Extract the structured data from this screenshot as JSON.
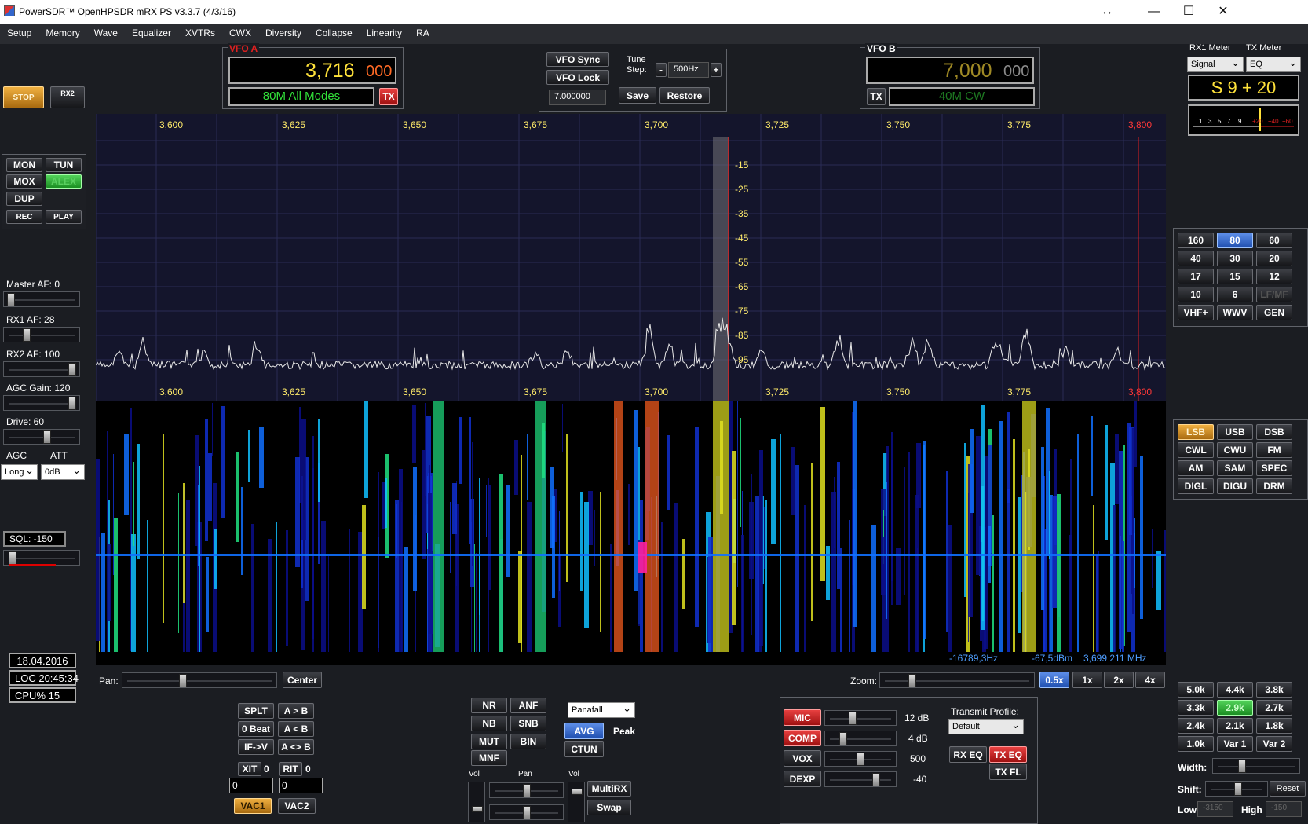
{
  "window": {
    "title": "PowerSDR™ OpenHPSDR mRX PS v3.3.7 (4/3/16)",
    "btn_resize": "↔",
    "btn_min": "—",
    "btn_max": "☐",
    "btn_close": "✕"
  },
  "menu": [
    "Setup",
    "Memory",
    "Wave",
    "Equalizer",
    "XVTRs",
    "CWX",
    "Diversity",
    "Collapse",
    "Linearity",
    "RA"
  ],
  "left": {
    "stop": "STOP",
    "rx2": "RX2",
    "mon": "MON",
    "tun": "TUN",
    "mox": "MOX",
    "alex": "ALEX",
    "dup": "DUP",
    "rec": "REC",
    "play": "PLAY",
    "master_af": "Master AF:  0",
    "rx1_af": "RX1 AF:  28",
    "rx2_af": "RX2 AF:  100",
    "agc_gain": "AGC Gain:  120",
    "drive": "Drive:  60",
    "agc": "AGC",
    "att": "ATT",
    "agc_val": "Long",
    "att_val": "0dB",
    "sql": "SQL:  -150",
    "date": "18.04.2016",
    "loc": "LOC 20:45:34",
    "cpu": "CPU%  15"
  },
  "vfoa": {
    "label": "VFO A",
    "freq_main": "3,716",
    "freq_sub": "000",
    "band": "80M All Modes",
    "tx": "TX"
  },
  "vfob": {
    "label": "VFO B",
    "freq_main": "7,000",
    "freq_sub": "000",
    "band": "40M CW",
    "tx": "TX"
  },
  "center": {
    "vfo_sync": "VFO Sync",
    "vfo_lock": "VFO Lock",
    "tune_step": "Tune\nStep:",
    "step_val": "500Hz",
    "minus": "-",
    "plus": "+",
    "freq_entry": "7.000000",
    "save": "Save",
    "restore": "Restore"
  },
  "meter": {
    "rx1_meter": "RX1 Meter",
    "tx_meter": "TX Meter",
    "rx_sel": "Signal",
    "tx_sel": "EQ",
    "reading": "S 9 + 20",
    "scale": [
      "1",
      "3",
      "5",
      "7",
      "9",
      "+20",
      "+40",
      "+60"
    ]
  },
  "spectrum": {
    "freq_ticks": [
      "3,600",
      "3,625",
      "3,650",
      "3,675",
      "3,700",
      "3,725",
      "3,750",
      "3,775",
      "3,800"
    ],
    "db_ticks": [
      "-15",
      "-25",
      "-35",
      "-45",
      "-55",
      "-65",
      "-75",
      "-85",
      "-95"
    ],
    "cursor_hz": "-16789,3Hz",
    "cursor_dbm": "-67,5dBm",
    "cursor_mhz": "3,699 211 MHz"
  },
  "bands": [
    "160",
    "80",
    "60",
    "40",
    "30",
    "20",
    "17",
    "15",
    "12",
    "10",
    "6",
    "LF/MF",
    "VHF+",
    "WWV",
    "GEN"
  ],
  "modes": [
    "LSB",
    "USB",
    "DSB",
    "CWL",
    "CWU",
    "FM",
    "AM",
    "SAM",
    "SPEC",
    "DIGL",
    "DIGU",
    "DRM"
  ],
  "filters": [
    "5.0k",
    "4.4k",
    "3.8k",
    "3.3k",
    "2.9k",
    "2.7k",
    "2.4k",
    "2.1k",
    "1.8k",
    "1.0k",
    "Var 1",
    "Var 2"
  ],
  "filter_ctrl": {
    "width": "Width:",
    "shift": "Shift:",
    "reset": "Reset",
    "low": "Low",
    "low_val": "-3150",
    "high": "High",
    "high_val": "-150"
  },
  "pan": {
    "pan": "Pan:",
    "center": "Center",
    "zoom": "Zoom:",
    "z05": "0.5x",
    "z1": "1x",
    "z2": "2x",
    "z4": "4x"
  },
  "split": {
    "splt": "SPLT",
    "atob": "A > B",
    "zerobeat": "0 Beat",
    "btoa": "A < B",
    "ifv": "IF->V",
    "swap": "A <> B",
    "xit": "XIT",
    "xit_v": "0",
    "rit": "RIT",
    "rit_v": "0",
    "xit_num": "0",
    "rit_num": "0",
    "vac1": "VAC1",
    "vac2": "VAC2"
  },
  "dsp": {
    "nr": "NR",
    "anf": "ANF",
    "nb": "NB",
    "snb": "SNB",
    "mut": "MUT",
    "bin": "BIN",
    "mnf": "MNF",
    "display_mode": "Panafall",
    "avg": "AVG",
    "peak": "Peak",
    "ctun": "CTUN",
    "vol1": "Vol",
    "pan": "Pan",
    "vol2": "Vol",
    "multirx": "MultiRX",
    "swap": "Swap"
  },
  "tx": {
    "mic": "MIC",
    "mic_v": "12 dB",
    "comp": "COMP",
    "comp_v": "4 dB",
    "vox": "VOX",
    "vox_v": "500",
    "dexp": "DEXP",
    "dexp_v": "-40",
    "profile_lbl": "Transmit Profile:",
    "profile": "Default",
    "rxeq": "RX EQ",
    "txeq": "TX EQ",
    "txfl": "TX FL"
  }
}
